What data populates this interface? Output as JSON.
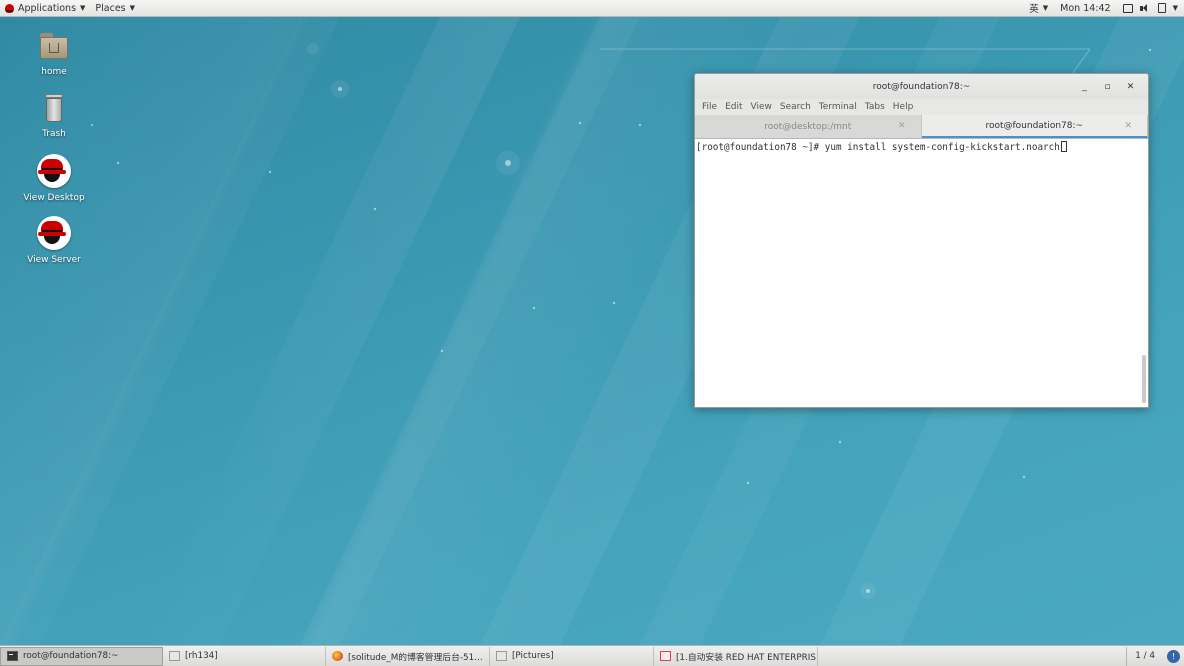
{
  "top_panel": {
    "applications_label": "Applications",
    "places_label": "Places",
    "input_method": "英",
    "clock": "Mon 14:42"
  },
  "desktop_icons": [
    {
      "label": "home",
      "icon": "home-folder-icon"
    },
    {
      "label": "Trash",
      "icon": "trash-icon"
    },
    {
      "label": "View Desktop",
      "icon": "redhat-icon"
    },
    {
      "label": "View Server",
      "icon": "redhat-icon"
    }
  ],
  "terminal": {
    "title": "root@foundation78:~",
    "menu": [
      "File",
      "Edit",
      "View",
      "Search",
      "Terminal",
      "Tabs",
      "Help"
    ],
    "tabs": [
      {
        "label": "root@desktop:/mnt",
        "active": false
      },
      {
        "label": "root@foundation78:~",
        "active": true
      }
    ],
    "prompt": "[root@foundation78 ~]#",
    "command": "yum install system-config-kickstart.noarch"
  },
  "taskbar": {
    "items": [
      {
        "label": "root@foundation78:~",
        "icon": "terminal-icon",
        "active": true
      },
      {
        "label": "[rh134]",
        "icon": "window-icon",
        "active": false
      },
      {
        "label": "[solitude_M的博客管理后台-51...",
        "icon": "firefox-icon",
        "active": false
      },
      {
        "label": "[Pictures]",
        "icon": "window-icon",
        "active": false
      },
      {
        "label": "[1.自动安装 RED HAT ENTERPRIS...",
        "icon": "document-icon",
        "active": false
      }
    ],
    "workspace": "1 / 4"
  },
  "colors": {
    "desktop_bg": "#3f96ae",
    "tab_accent": "#4a90d9"
  }
}
